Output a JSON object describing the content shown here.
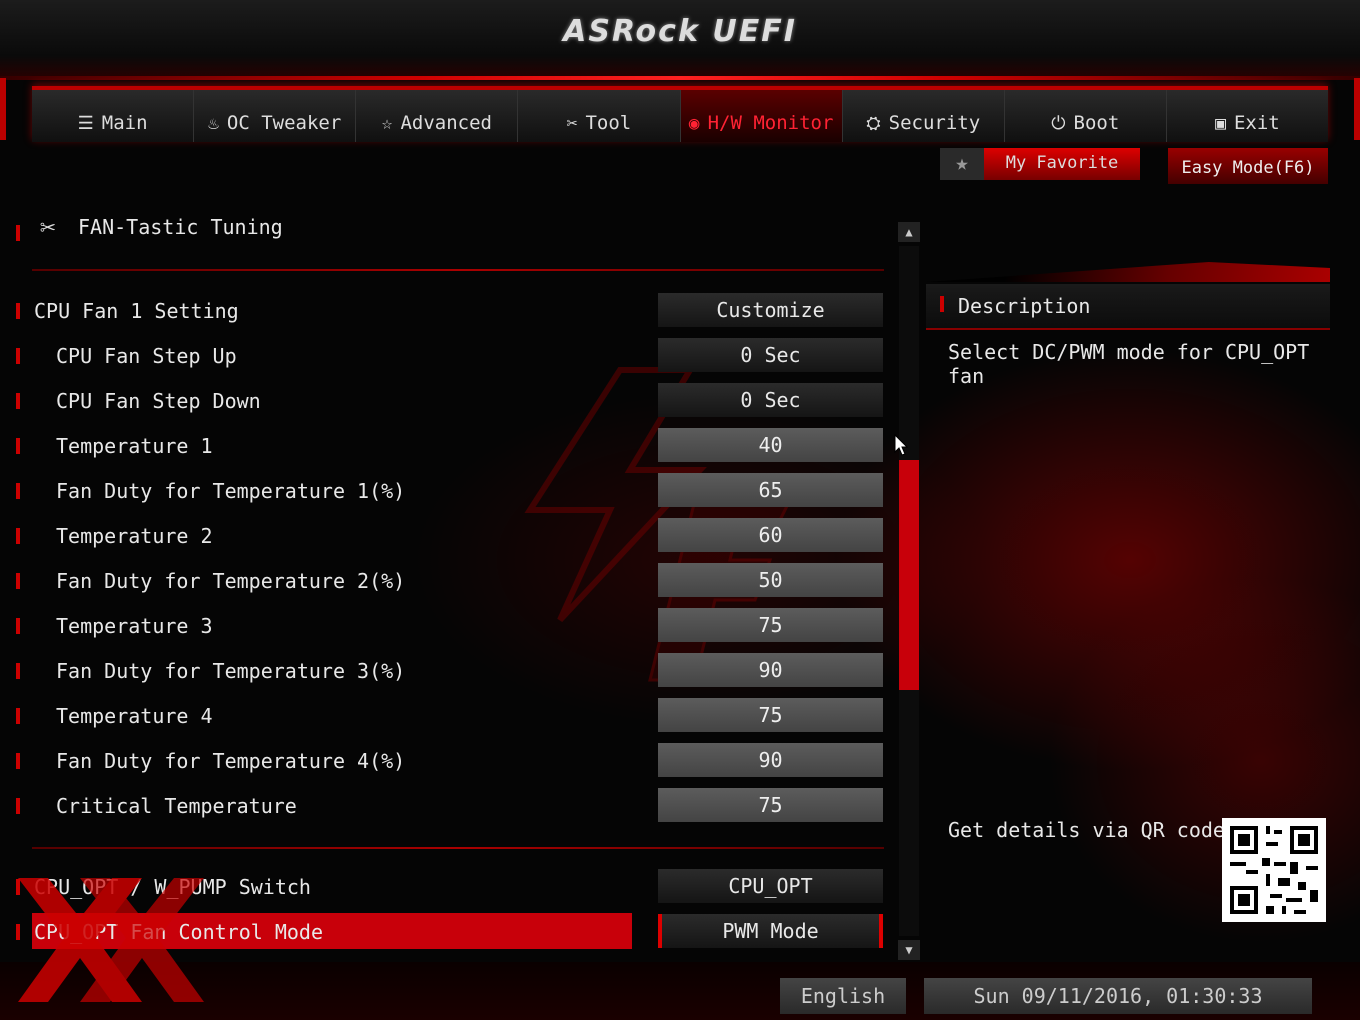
{
  "header": {
    "logo": "ASRock UEFI"
  },
  "tabs": [
    {
      "label": "Main",
      "icon": "list-icon"
    },
    {
      "label": "OC Tweaker",
      "icon": "flame-icon"
    },
    {
      "label": "Advanced",
      "icon": "star-icon"
    },
    {
      "label": "Tool",
      "icon": "tools-icon"
    },
    {
      "label": "H/W Monitor",
      "icon": "monitor-icon",
      "active": true
    },
    {
      "label": "Security",
      "icon": "shield-icon"
    },
    {
      "label": "Boot",
      "icon": "power-icon"
    },
    {
      "label": "Exit",
      "icon": "exit-icon"
    }
  ],
  "favorite": {
    "label": "My Favorite"
  },
  "easy_mode": {
    "label": "Easy Mode(F6)"
  },
  "section": {
    "title": "FAN-Tastic Tuning"
  },
  "settings": [
    {
      "label": "CPU Fan 1 Setting",
      "value": "Customize"
    },
    {
      "label": "CPU Fan Step Up",
      "value": "0 Sec"
    },
    {
      "label": "CPU Fan Step Down",
      "value": "0 Sec"
    },
    {
      "label": "Temperature 1",
      "value": "40"
    },
    {
      "label": "Fan Duty for Temperature 1(%)",
      "value": "65"
    },
    {
      "label": "Temperature 2",
      "value": "60"
    },
    {
      "label": "Fan Duty for Temperature 2(%)",
      "value": "50"
    },
    {
      "label": "Temperature 3",
      "value": "75"
    },
    {
      "label": "Fan Duty for Temperature 3(%)",
      "value": "90"
    },
    {
      "label": "Temperature 4",
      "value": "75"
    },
    {
      "label": "Fan Duty for Temperature 4(%)",
      "value": "90"
    },
    {
      "label": "Critical Temperature",
      "value": "75"
    },
    {
      "label": "CPU_OPT / W_PUMP Switch",
      "value": "CPU_OPT"
    },
    {
      "label": "CPU_OPT Fan Control Mode",
      "value": "PWM Mode"
    }
  ],
  "description": {
    "title": "Description",
    "text": "Select DC/PWM mode for CPU_OPT fan",
    "qr_label": "Get details via QR code"
  },
  "footer": {
    "language": "English",
    "datetime": "Sun 09/11/2016, 01:30:33"
  },
  "colors": {
    "accent": "#c8000a",
    "background": "#050505"
  }
}
